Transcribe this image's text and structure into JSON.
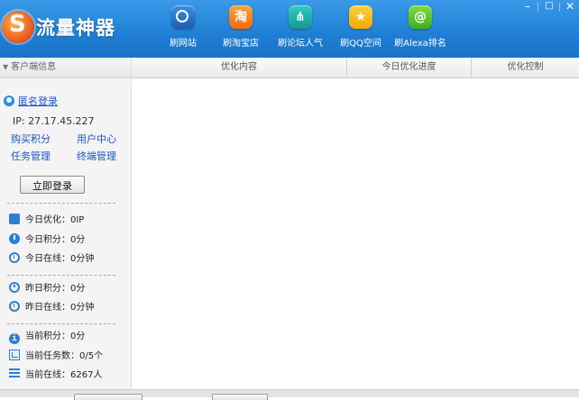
{
  "app": {
    "title": "流量神器"
  },
  "toolbar": {
    "items": [
      {
        "label": "刷网站",
        "icon": "globe-icon",
        "glyph": ""
      },
      {
        "label": "刷淘宝店",
        "icon": "taobao-icon",
        "glyph": "淘"
      },
      {
        "label": "刷论坛人气",
        "icon": "forum-icon",
        "glyph": "⋔"
      },
      {
        "label": "刷QQ空间",
        "icon": "star-icon",
        "glyph": "★"
      },
      {
        "label": "刷Alexa排名",
        "icon": "alexa-icon",
        "glyph": "@"
      }
    ]
  },
  "window_controls": {
    "minimize": "–",
    "restore": "□",
    "close": "✕"
  },
  "sidebar": {
    "header": "客户端信息",
    "anon_login": "匿名登录",
    "ip": "IP: 27.17.45.227",
    "links": {
      "buy_points": "购买积分",
      "user_center": "用户中心",
      "task_mgmt": "任务管理",
      "terminal_mgmt": "终端管理"
    },
    "login_button": "立即登录",
    "stats": {
      "today_opt": "今日优化：0IP",
      "today_points": "今日积分：0分",
      "today_online": "今日在线：0分钟",
      "yest_points": "昨日积分：0分",
      "yest_online": "昨日在线：0分钟",
      "cur_points": "当前积分：0分",
      "cur_tasks": "当前任务数：0/5个",
      "cur_online": "当前在线：6267人"
    }
  },
  "table": {
    "columns": [
      "优化内容",
      "今日优化进度",
      "优化控制"
    ]
  },
  "colors": {
    "titlebar": "#1f7fd4",
    "link": "#1b55c4",
    "icon_blue": "#2d7fd6"
  }
}
